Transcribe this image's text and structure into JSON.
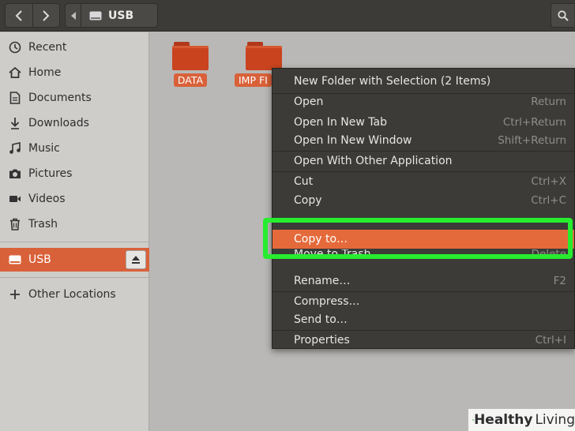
{
  "header": {
    "location": "USB",
    "icons": {
      "back": "chevron-left-icon",
      "forward": "chevron-right-icon",
      "path_back": "caret-left-icon",
      "drive": "drive-icon",
      "search": "search-icon"
    }
  },
  "sidebar": {
    "items": [
      {
        "label": "Recent",
        "icon": "clock-icon"
      },
      {
        "label": "Home",
        "icon": "home-icon"
      },
      {
        "label": "Documents",
        "icon": "document-icon"
      },
      {
        "label": "Downloads",
        "icon": "download-icon"
      },
      {
        "label": "Music",
        "icon": "music-icon"
      },
      {
        "label": "Pictures",
        "icon": "camera-icon"
      },
      {
        "label": "Videos",
        "icon": "video-icon"
      },
      {
        "label": "Trash",
        "icon": "trash-icon"
      }
    ],
    "device": {
      "label": "USB",
      "icon": "drive-icon",
      "selected": true,
      "eject_icon": "eject-icon"
    },
    "other": {
      "label": "Other Locations",
      "icon": "plus-icon"
    }
  },
  "files": [
    {
      "name": "DATA",
      "type": "folder"
    },
    {
      "name": "IMP FI",
      "type": "folder"
    }
  ],
  "context_menu": {
    "items": [
      {
        "label": "New Folder with Selection (2 Items)",
        "accel": ""
      },
      {
        "label": "Open",
        "accel": "Return"
      },
      {
        "label": "Open In New Tab",
        "accel": "Ctrl+Return"
      },
      {
        "label": "Open In New Window",
        "accel": "Shift+Return"
      },
      {
        "label": "Open With Other Application",
        "accel": ""
      },
      {
        "label": "Cut",
        "accel": "Ctrl+X"
      },
      {
        "label": "Copy",
        "accel": "Ctrl+C"
      },
      {
        "label": "Copy to…",
        "accel": "",
        "highlighted": true
      },
      {
        "label": "Move to Trash",
        "accel": "Delete"
      },
      {
        "label": "Rename…",
        "accel": "F2"
      },
      {
        "label": "Compress…",
        "accel": ""
      },
      {
        "label": "Send to…",
        "accel": ""
      },
      {
        "label": "Properties",
        "accel": "Ctrl+I"
      }
    ]
  },
  "watermark": {
    "part1": "Healthy",
    "part2": "Living"
  },
  "colors": {
    "accent": "#d9613a",
    "menu_highlight": "#e46a3b",
    "callout": "#26ed2e",
    "folder": "#c9431f"
  }
}
